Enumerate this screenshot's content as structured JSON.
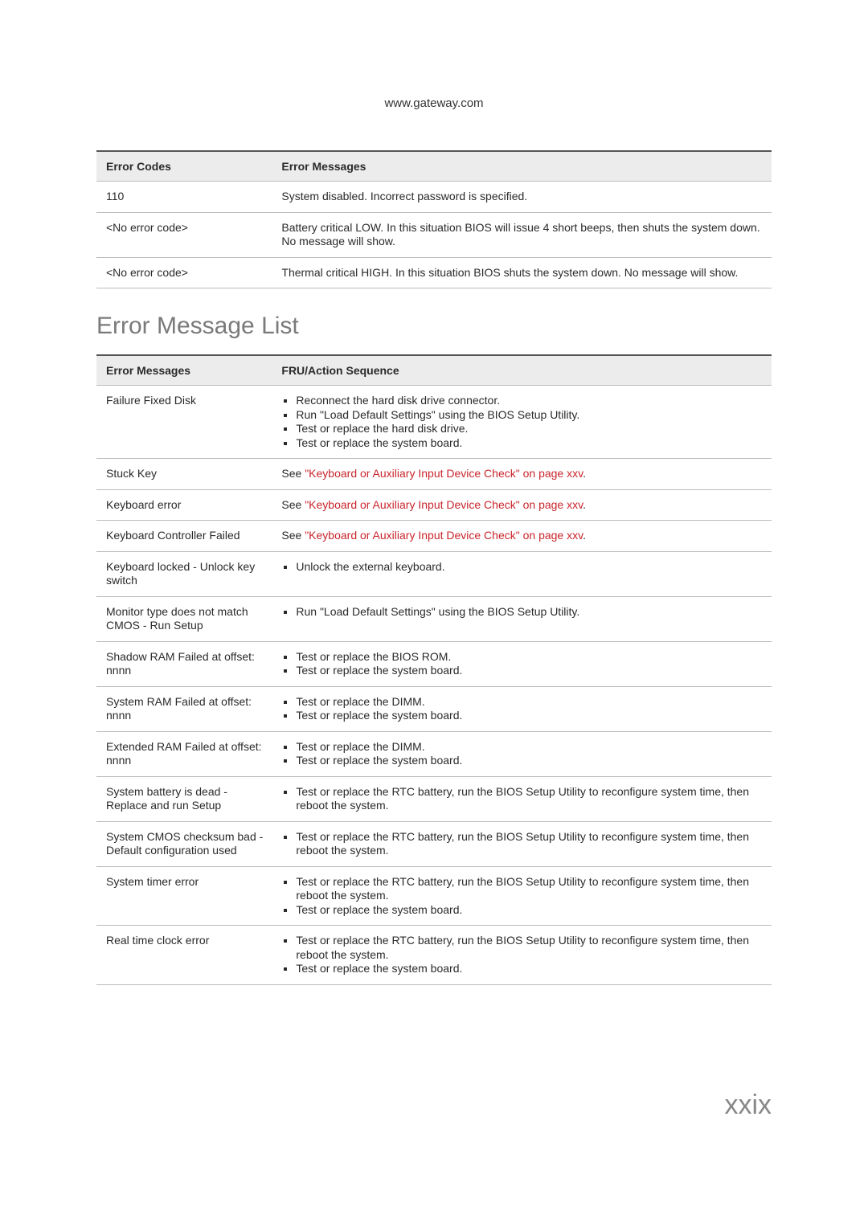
{
  "header_url": "www.gateway.com",
  "table1": {
    "headers": {
      "a": "Error Codes",
      "b": "Error Messages"
    },
    "rows": [
      {
        "code": "110",
        "msg": "System disabled. Incorrect password is specified."
      },
      {
        "code": "<No error code>",
        "msg": "Battery critical LOW. In this situation BIOS will issue 4 short beeps, then shuts the system down. No message will show."
      },
      {
        "code": "<No error code>",
        "msg": "Thermal critical HIGH. In this situation BIOS shuts the system down. No message will show."
      }
    ]
  },
  "section_title": "Error Message List",
  "table2": {
    "headers": {
      "a": "Error Messages",
      "b": "FRU/Action Sequence"
    },
    "rows": [
      {
        "msg": "Failure Fixed Disk",
        "actions": [
          "Reconnect the hard disk drive connector.",
          "Run \"Load Default Settings\" using the BIOS Setup Utility.",
          "Test or replace the hard disk drive.",
          "Test or replace the system board."
        ]
      },
      {
        "msg": "Stuck Key",
        "link_prefix": "See ",
        "link_text": "\"Keyboard or Auxiliary Input Device Check\" on page xxv",
        "link_suffix": "."
      },
      {
        "msg": "Keyboard error",
        "link_prefix": "See ",
        "link_text": "\"Keyboard or Auxiliary Input Device Check\" on page xxv",
        "link_suffix": "."
      },
      {
        "msg": "Keyboard Controller Failed",
        "link_prefix": "See ",
        "link_text": "\"Keyboard or Auxiliary Input Device Check\" on page xxv",
        "link_suffix": "."
      },
      {
        "msg": "Keyboard locked - Unlock key switch",
        "actions": [
          "Unlock the external keyboard."
        ]
      },
      {
        "msg": "Monitor type does not match CMOS - Run Setup",
        "actions": [
          "Run \"Load Default Settings\" using the BIOS Setup Utility."
        ]
      },
      {
        "msg": "Shadow RAM Failed at offset: nnnn",
        "actions": [
          "Test or replace the BIOS ROM.",
          "Test or replace the system board."
        ]
      },
      {
        "msg": "System RAM Failed at offset: nnnn",
        "actions": [
          "Test or replace the DIMM.",
          "Test or replace the system board."
        ]
      },
      {
        "msg": "Extended RAM Failed at offset: nnnn",
        "actions": [
          "Test or replace the DIMM.",
          "Test or replace the system board."
        ]
      },
      {
        "msg": "System battery is dead - Replace and run Setup",
        "actions": [
          "Test or replace the RTC battery, run the BIOS Setup Utility to reconfigure system time, then reboot the system."
        ]
      },
      {
        "msg": "System CMOS checksum bad - Default configuration used",
        "actions": [
          "Test or replace the RTC battery, run the BIOS Setup Utility to reconfigure system time, then reboot the system."
        ]
      },
      {
        "msg": "System timer error",
        "actions": [
          "Test or replace the RTC battery, run the BIOS Setup Utility to reconfigure system time, then reboot the system.",
          "Test or replace the system board."
        ]
      },
      {
        "msg": "Real time clock error",
        "actions": [
          "Test or replace the RTC battery, run the BIOS Setup Utility to reconfigure system time, then reboot the system.",
          "Test or replace the system board."
        ]
      }
    ]
  },
  "page_number": "xxix"
}
